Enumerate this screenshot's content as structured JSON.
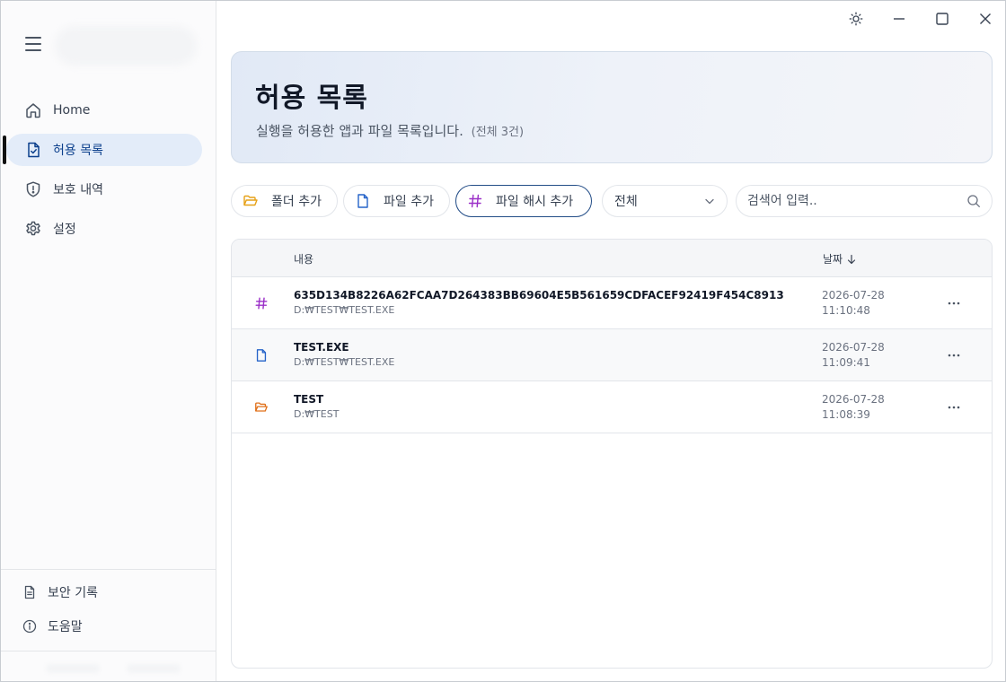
{
  "titlebar": {
    "theme_icon": "sun-icon",
    "minimize_icon": "minimize-icon",
    "maximize_icon": "maximize-icon",
    "close_icon": "close-icon"
  },
  "sidebar": {
    "menu_icon": "hamburger-icon",
    "items": [
      {
        "label": "Home",
        "icon": "home-icon"
      },
      {
        "label": "허용 목록",
        "icon": "file-check-icon",
        "active": true
      },
      {
        "label": "보호 내역",
        "icon": "shield-alert-icon"
      },
      {
        "label": "설정",
        "icon": "gear-icon"
      }
    ],
    "bottom_items": [
      {
        "label": "보안 기록",
        "icon": "document-icon"
      },
      {
        "label": "도움말",
        "icon": "info-icon"
      }
    ]
  },
  "hero": {
    "title": "허용 목록",
    "subtitle": "실행을 허용한 앱과 파일 목록입니다.",
    "count": "(전체 3건)"
  },
  "toolbar": {
    "add_folder": "폴더 추가",
    "add_file": "파일 추가",
    "add_hash": "파일 해시 추가",
    "filter_value": "전체",
    "search_placeholder": "검색어 입력.."
  },
  "table": {
    "col_content": "내용",
    "col_date": "날짜",
    "rows": [
      {
        "icon": "hash-icon",
        "name": "635D134B8226A62FCAA7D264383BB69604E5B561659CDFACEF92419F454C8913",
        "path": "D:₩TEST₩TEST.EXE",
        "date": "2026-07-28",
        "time": "11:10:48"
      },
      {
        "icon": "file-icon",
        "name": "TEST.EXE",
        "path": "D:₩TEST₩TEST.EXE",
        "date": "2026-07-28",
        "time": "11:09:41"
      },
      {
        "icon": "folder-open-icon",
        "name": "TEST",
        "path": "D:₩TEST",
        "date": "2026-07-28",
        "time": "11:08:39"
      }
    ]
  },
  "colors": {
    "accent": "#234d87",
    "active_nav_bg": "#e3ecf9",
    "hash_icon": "#9b30c8",
    "file_icon": "#2563c9",
    "folder_icon": "#e0701a",
    "folder_button_icon": "#e6a117"
  }
}
